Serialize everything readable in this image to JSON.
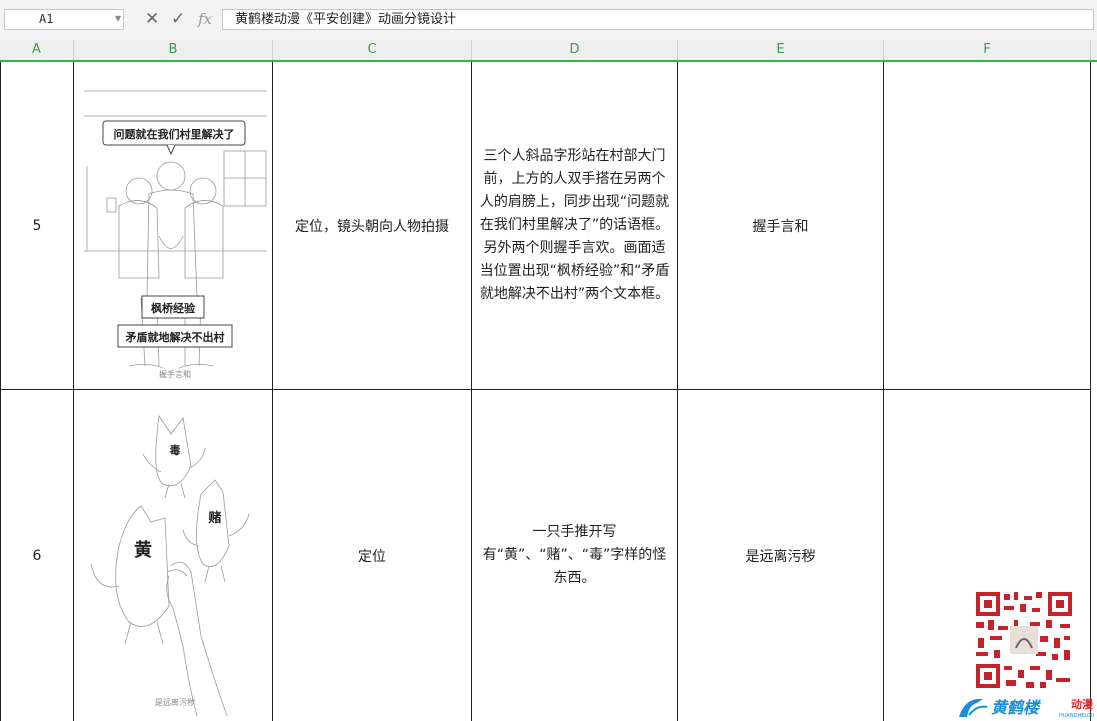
{
  "formula_bar": {
    "cell_ref": "A1",
    "formula_text": "黄鹤楼动漫《平安创建》动画分镜设计",
    "icons": {
      "cancel": "close-icon",
      "confirm": "check-icon",
      "function": "fx-icon"
    }
  },
  "columns": [
    "A",
    "B",
    "C",
    "D",
    "E",
    "F"
  ],
  "rows": [
    {
      "number": "5",
      "sketch_texts": {
        "bubble": "问题就在我们村里解决了",
        "box1": "枫桥经验",
        "box2": "矛盾就地解决不出村",
        "caption": "握手言和"
      },
      "shot": "定位，镜头朝向人物拍摄",
      "description": "三个人斜品字形站在村部大门前，上方的人双手搭在另两个人的肩膀上，同步出现“问题就在我们村里解决了”的话语框。另外两个则握手言欢。画面适当位置出现“枫桥经验”和“矛盾就地解决不出村”两个文本框。",
      "dialogue": "握手言和",
      "notes": ""
    },
    {
      "number": "6",
      "sketch_texts": {
        "monster1": "毒",
        "monster2": "赌",
        "monster3": "黄",
        "caption": "是远离污秽"
      },
      "shot": "定位",
      "description": "一只手推开写有“黄”、“赌”、“毒”字样的怪东西。",
      "dialogue": "是远离污秽",
      "notes": ""
    }
  ],
  "watermark": {
    "logo_text": "黄鹤楼",
    "logo_suffix": "动漫",
    "logo_sub": "HUANGHELOU",
    "accent": "#1a8fd8",
    "accent_red": "#e0262b"
  }
}
